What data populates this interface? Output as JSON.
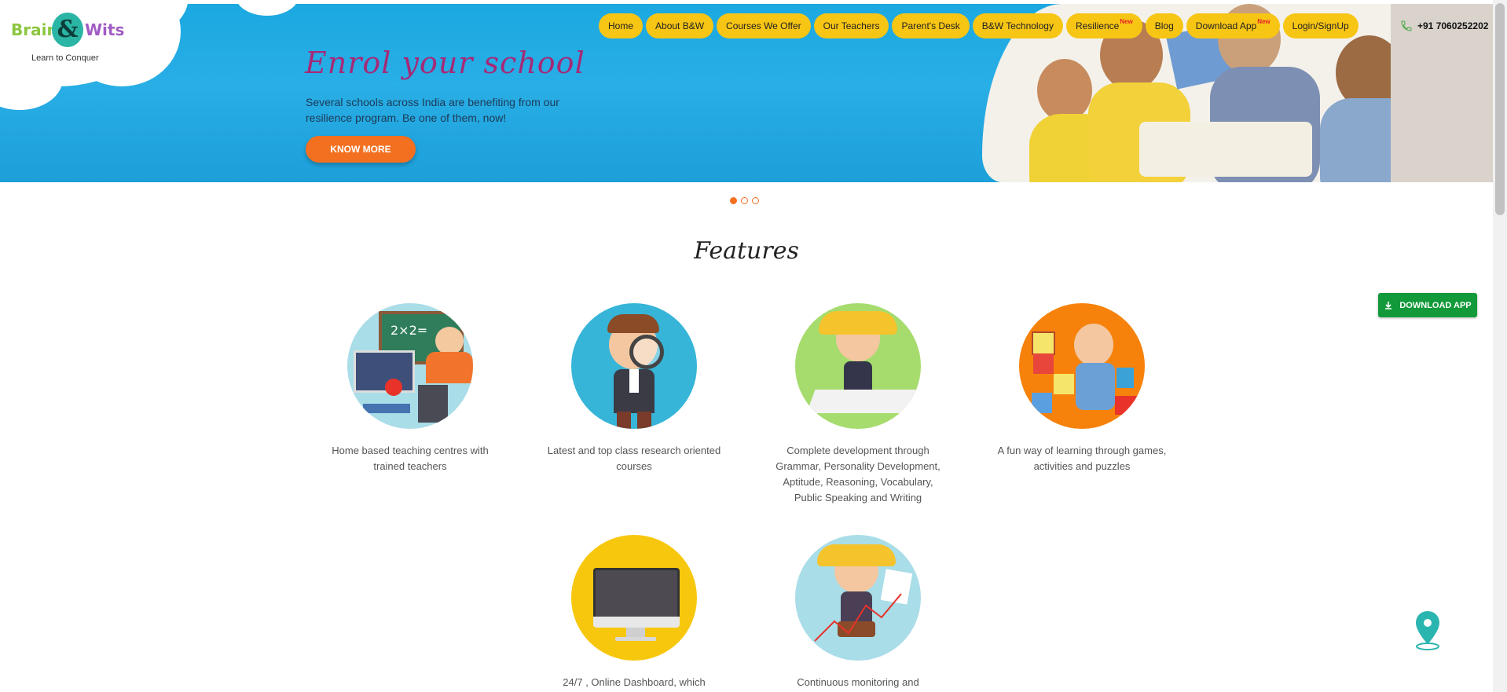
{
  "logo": {
    "brain": "Brain",
    "amp": "&",
    "wits": "Wits",
    "tagline": "Learn to Conquer"
  },
  "hero": {
    "title": "Enrol your school",
    "text": "Several schools across India are benefiting from our resilience program. Be one of them, now!",
    "button_label": "KNOW MORE"
  },
  "nav": {
    "items": [
      {
        "label": "Home",
        "badge": ""
      },
      {
        "label": "About B&W",
        "badge": ""
      },
      {
        "label": "Courses We Offer",
        "badge": ""
      },
      {
        "label": "Our Teachers",
        "badge": ""
      },
      {
        "label": "Parent's Desk",
        "badge": ""
      },
      {
        "label": "B&W Technology",
        "badge": ""
      },
      {
        "label": "Resilience",
        "badge": "New"
      },
      {
        "label": "Blog",
        "badge": ""
      },
      {
        "label": "Download App",
        "badge": "New"
      },
      {
        "label": "Login/SignUp",
        "badge": ""
      }
    ],
    "phone": "+91 7060252202",
    "phone_icon": "phone-icon"
  },
  "carousel": {
    "slides": 3,
    "active": 0
  },
  "features": {
    "title": "Features",
    "items": [
      {
        "text": "Home based teaching centres with trained teachers",
        "color": "#a9dde8",
        "icon": "online-education-icon"
      },
      {
        "text": "Latest and top class research oriented courses",
        "color": "#36b5d8",
        "icon": "magnifier-boy-icon"
      },
      {
        "text": "Complete development through Grammar, Personality Development, Aptitude, Reasoning, Vocabulary, Public Speaking and Writing",
        "color": "#a6dc6e",
        "icon": "girl-paper-plane-icon"
      },
      {
        "text": "A fun way of learning through games, activities and puzzles",
        "color": "#f7820b",
        "icon": "alphabet-blocks-icon"
      },
      {
        "text": "24/7 , Online Dashboard, which",
        "color": "#f7c70e",
        "icon": "monitor-icon"
      },
      {
        "text": "Continuous monitoring and",
        "color": "#a9dde8",
        "icon": "girl-chart-icon"
      }
    ]
  },
  "download_button": {
    "label": "DOWNLOAD APP",
    "icon": "download-icon"
  },
  "map_pin": {
    "icon": "location-pin-icon",
    "color": "#2bb5b0"
  }
}
